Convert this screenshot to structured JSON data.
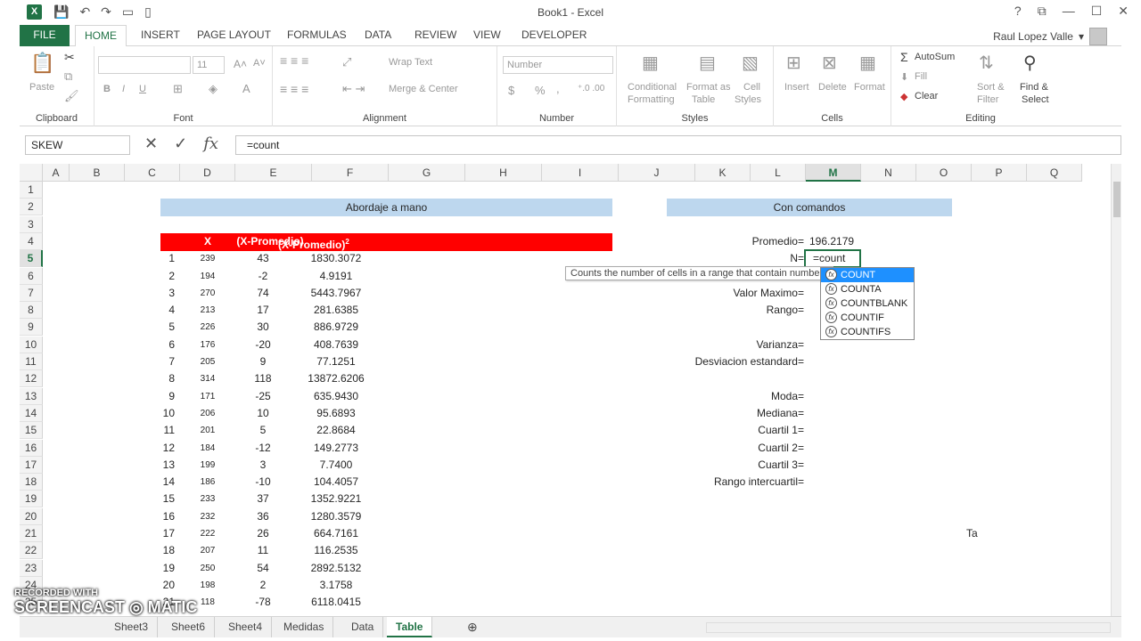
{
  "window": {
    "title": "Book1 - Excel",
    "excel_logo": "X",
    "user": "Raul Lopez Valle"
  },
  "ribbon_tabs": [
    "FILE",
    "HOME",
    "INSERT",
    "PAGE LAYOUT",
    "FORMULAS",
    "DATA",
    "REVIEW",
    "VIEW",
    "DEVELOPER"
  ],
  "ribbon": {
    "clipboard": {
      "paste": "Paste",
      "label": "Clipboard"
    },
    "font": {
      "size": "11",
      "bold": "B",
      "italic": "I",
      "underline": "U",
      "label": "Font"
    },
    "alignment": {
      "wrap": "Wrap Text",
      "merge": "Merge & Center",
      "label": "Alignment"
    },
    "number": {
      "format": "Number",
      "currency": "$",
      "percent": "%",
      "comma": ",",
      "label": "Number"
    },
    "styles": {
      "conditional": "Conditional",
      "conditional2": "Formatting",
      "format_as": "Format as",
      "format_as2": "Table",
      "cell_styles": "Cell",
      "cell_styles2": "Styles",
      "label": "Styles"
    },
    "cells": {
      "insert": "Insert",
      "delete": "Delete",
      "format": "Format",
      "label": "Cells"
    },
    "editing": {
      "autosum": "AutoSum",
      "fill": "Fill",
      "clear": "Clear",
      "sort": "Sort &",
      "sort2": "Filter",
      "find": "Find &",
      "find2": "Select",
      "label": "Editing"
    }
  },
  "formula_bar": {
    "name_box": "SKEW",
    "fx": "fx",
    "formula": "=count"
  },
  "columns": [
    "A",
    "B",
    "C",
    "D",
    "E",
    "F",
    "G",
    "H",
    "I",
    "J",
    "K",
    "L",
    "M",
    "N",
    "O",
    "P",
    "Q"
  ],
  "rows": [
    "1",
    "2",
    "3",
    "4",
    "5",
    "6",
    "7",
    "8",
    "9",
    "10",
    "11",
    "12",
    "13",
    "14",
    "15",
    "16",
    "17",
    "18",
    "19",
    "20",
    "21",
    "22",
    "23",
    "24",
    "25"
  ],
  "sheet": {
    "banner_left": "Abordaje a mano",
    "banner_right": "Con comandos",
    "header_x": "X",
    "header_dev": "(X-Promedio)",
    "header_sq": "(X-Promedio)",
    "header_sq_sup": "2",
    "index": [
      "1",
      "2",
      "3",
      "4",
      "5",
      "6",
      "7",
      "8",
      "9",
      "10",
      "11",
      "12",
      "13",
      "14",
      "15",
      "16",
      "17",
      "18",
      "19",
      "20",
      "21"
    ],
    "x": [
      "239",
      "194",
      "270",
      "213",
      "226",
      "176",
      "205",
      "314",
      "171",
      "206",
      "201",
      "184",
      "199",
      "186",
      "233",
      "232",
      "222",
      "207",
      "250",
      "198",
      "118"
    ],
    "dev": [
      "43",
      "-2",
      "74",
      "17",
      "30",
      "-20",
      "9",
      "118",
      "-25",
      "10",
      "5",
      "-12",
      "3",
      "-10",
      "37",
      "36",
      "26",
      "11",
      "54",
      "2",
      "-78"
    ],
    "sq": [
      "1830.3072",
      "4.9191",
      "5443.7967",
      "281.6385",
      "886.9729",
      "408.7639",
      "77.1251",
      "13872.6206",
      "635.9430",
      "95.6893",
      "22.8684",
      "149.2773",
      "7.7400",
      "104.4057",
      "1352.9221",
      "1280.3579",
      "664.7161",
      "116.2535",
      "2892.5132",
      "3.1758",
      "6118.0415"
    ],
    "labels": {
      "promedio": "Promedio=",
      "promedio_val": "196.2179",
      "n": "N=",
      "valor_max": "Valor Maximo=",
      "rango": "Rango=",
      "varianza": "Varianza=",
      "desv": "Desviacion estandard=",
      "moda": "Moda=",
      "mediana": "Mediana=",
      "q1": "Cuartil 1=",
      "q2": "Cuartil 2=",
      "q3": "Cuartil 3=",
      "rango_iq": "Rango intercuartil=",
      "ta": "Ta"
    },
    "editing_value": "=count"
  },
  "tooltip": "Counts the number of cells in a range that contain numbers",
  "autocomplete": [
    "COUNT",
    "COUNTA",
    "COUNTBLANK",
    "COUNTIF",
    "COUNTIFS"
  ],
  "sheet_tabs": [
    "Sheet3",
    "Sheet6",
    "Sheet4",
    "Medidas",
    "Data",
    "Table"
  ],
  "watermark": {
    "line1": "RECORDED WITH",
    "line2": "SCREENCAST ◎ MATIC"
  }
}
